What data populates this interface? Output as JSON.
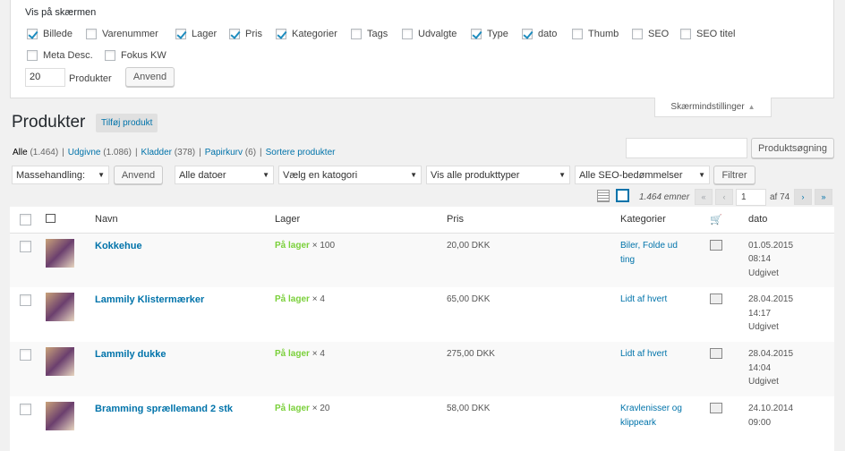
{
  "screen_options": {
    "title": "Vis på skærmen",
    "columns": [
      {
        "label": "Billede",
        "checked": true
      },
      {
        "label": "Varenummer",
        "checked": false
      },
      {
        "label": "Lager",
        "checked": true
      },
      {
        "label": "Pris",
        "checked": true
      },
      {
        "label": "Kategorier",
        "checked": true
      },
      {
        "label": "Tags",
        "checked": false
      },
      {
        "label": "Udvalgte",
        "checked": false
      },
      {
        "label": "Type",
        "checked": true
      },
      {
        "label": "dato",
        "checked": true
      },
      {
        "label": "Thumb",
        "checked": false
      },
      {
        "label": "SEO",
        "checked": false
      },
      {
        "label": "SEO titel",
        "checked": false
      },
      {
        "label": "Meta Desc.",
        "checked": false
      },
      {
        "label": "Fokus KW",
        "checked": false
      }
    ],
    "per_page_value": "20",
    "per_page_label": "Produkter",
    "apply_label": "Anvend",
    "tab_label": "Skærmindstillinger"
  },
  "header": {
    "title": "Produkter",
    "add_label": "Tilføj produkt"
  },
  "filters_links": {
    "all": "Alle",
    "all_count": "(1.464)",
    "published": "Udgivne",
    "published_count": "(1.086)",
    "drafts": "Kladder",
    "drafts_count": "(378)",
    "trash": "Papirkurv",
    "trash_count": "(6)",
    "sort": "Sortere produkter"
  },
  "search": {
    "button": "Produktsøgning",
    "value": ""
  },
  "toolbar": {
    "bulk": "Massehandling:",
    "apply": "Anvend",
    "dates": "Alle datoer",
    "category": "Vælg en katogori",
    "types": "Vis alle produkttyper",
    "seo": "Alle SEO-bedømmelser",
    "filter": "Filtrer"
  },
  "pagination": {
    "items": "1.464 emner",
    "current": "1",
    "of": "af 74",
    "first": "«",
    "prev": "‹",
    "next": "›",
    "last": "»"
  },
  "table": {
    "headers": {
      "name": "Navn",
      "stock": "Lager",
      "price": "Pris",
      "categories": "Kategorier",
      "date": "dato"
    },
    "rows": [
      {
        "name": "Kokkehue",
        "stock": "På lager",
        "qty": "× 100",
        "price": "20,00 DKK",
        "cat1": "Biler, Folde ud",
        "cat2": "ting",
        "date1": "01.05.2015",
        "date2": "08:14",
        "status": "Udgivet"
      },
      {
        "name": "Lammily Klistermærker",
        "stock": "På lager",
        "qty": "× 4",
        "price": "65,00 DKK",
        "cat1": "Lidt af hvert",
        "cat2": "",
        "date1": "28.04.2015",
        "date2": "14:17",
        "status": "Udgivet"
      },
      {
        "name": "Lammily dukke",
        "stock": "På lager",
        "qty": "× 4",
        "price": "275,00 DKK",
        "cat1": "Lidt af hvert",
        "cat2": "",
        "date1": "28.04.2015",
        "date2": "14:04",
        "status": "Udgivet"
      },
      {
        "name": "Bramming sprællemand 2 stk",
        "stock": "På lager",
        "qty": "× 20",
        "price": "58,00 DKK",
        "cat1": "Kravlenisser og",
        "cat2": "klippeark",
        "date1": "24.10.2014",
        "date2": "09:00",
        "status": ""
      }
    ]
  }
}
